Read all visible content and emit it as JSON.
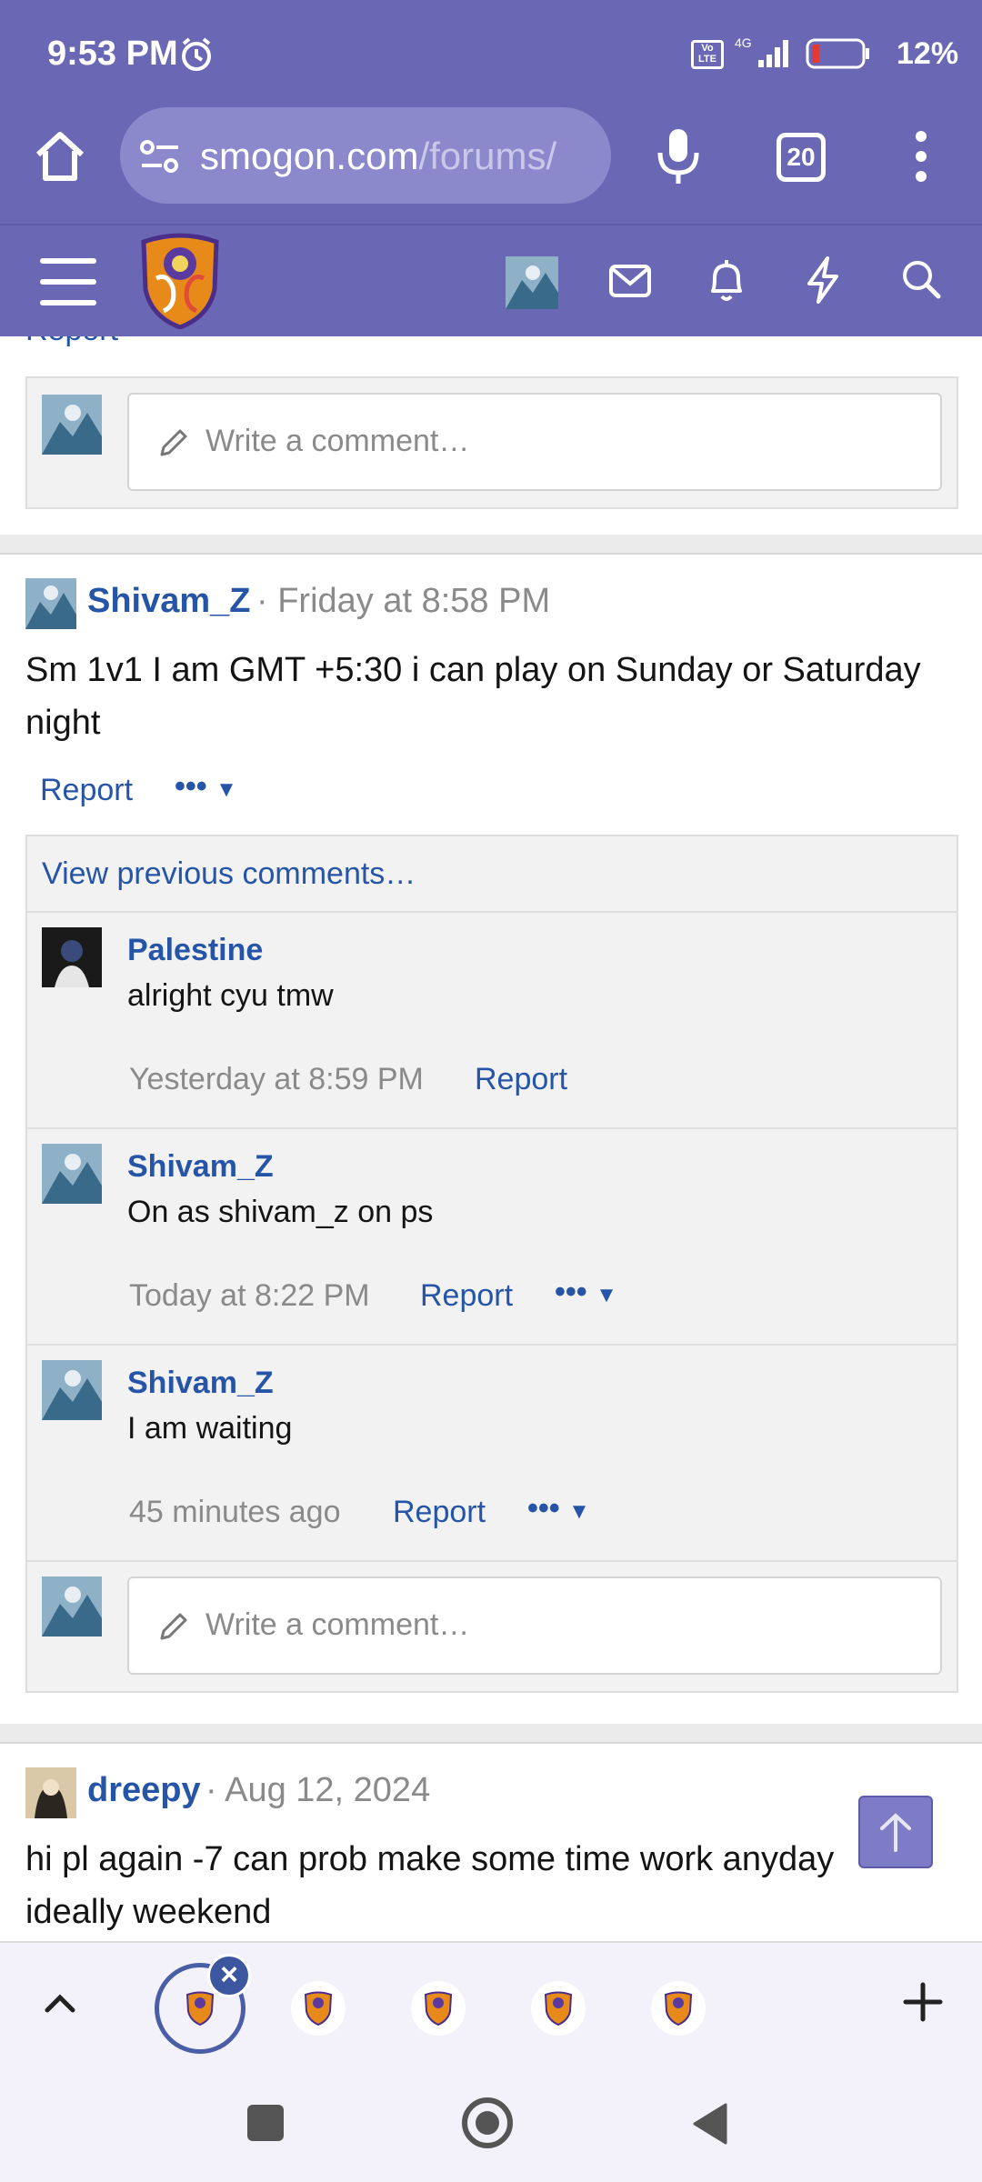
{
  "status": {
    "time": "9:53 PM",
    "network": "4G",
    "battery": "12%",
    "volte": "Vo LTE"
  },
  "browser": {
    "url_domain": "smogon.com",
    "url_path": "/forums/",
    "tab_count": "20"
  },
  "thread": {
    "top_report": "Report",
    "top_comment_placeholder": "Write a comment…",
    "post1": {
      "author": "Shivam_Z",
      "date": "· Friday at 8:58 PM",
      "text": "Sm 1v1 I am GMT +5:30 i can play on Sunday or Saturday night",
      "report": "Report",
      "more": "•••",
      "view_previous": "View previous comments…",
      "comments": [
        {
          "author": "Palestine",
          "text": "alright cyu tmw",
          "time": "Yesterday at 8:59 PM",
          "report": "Report",
          "more": ""
        },
        {
          "author": "Shivam_Z",
          "text": "On as shivam_z on ps",
          "time": "Today at 8:22 PM",
          "report": "Report",
          "more": "•••"
        },
        {
          "author": "Shivam_Z",
          "text": "I am waiting",
          "time": "45 minutes ago",
          "report": "Report",
          "more": "•••"
        }
      ],
      "comment_placeholder": "Write a comment…"
    },
    "post2": {
      "author": "dreepy",
      "date": "· Aug 12, 2024",
      "text": "hi pl again -7 can prob make some time work anyday ideally weekend"
    }
  },
  "colors": {
    "brand": "#6a68b5",
    "link": "#2655a8",
    "muted": "#8a8a8a"
  }
}
